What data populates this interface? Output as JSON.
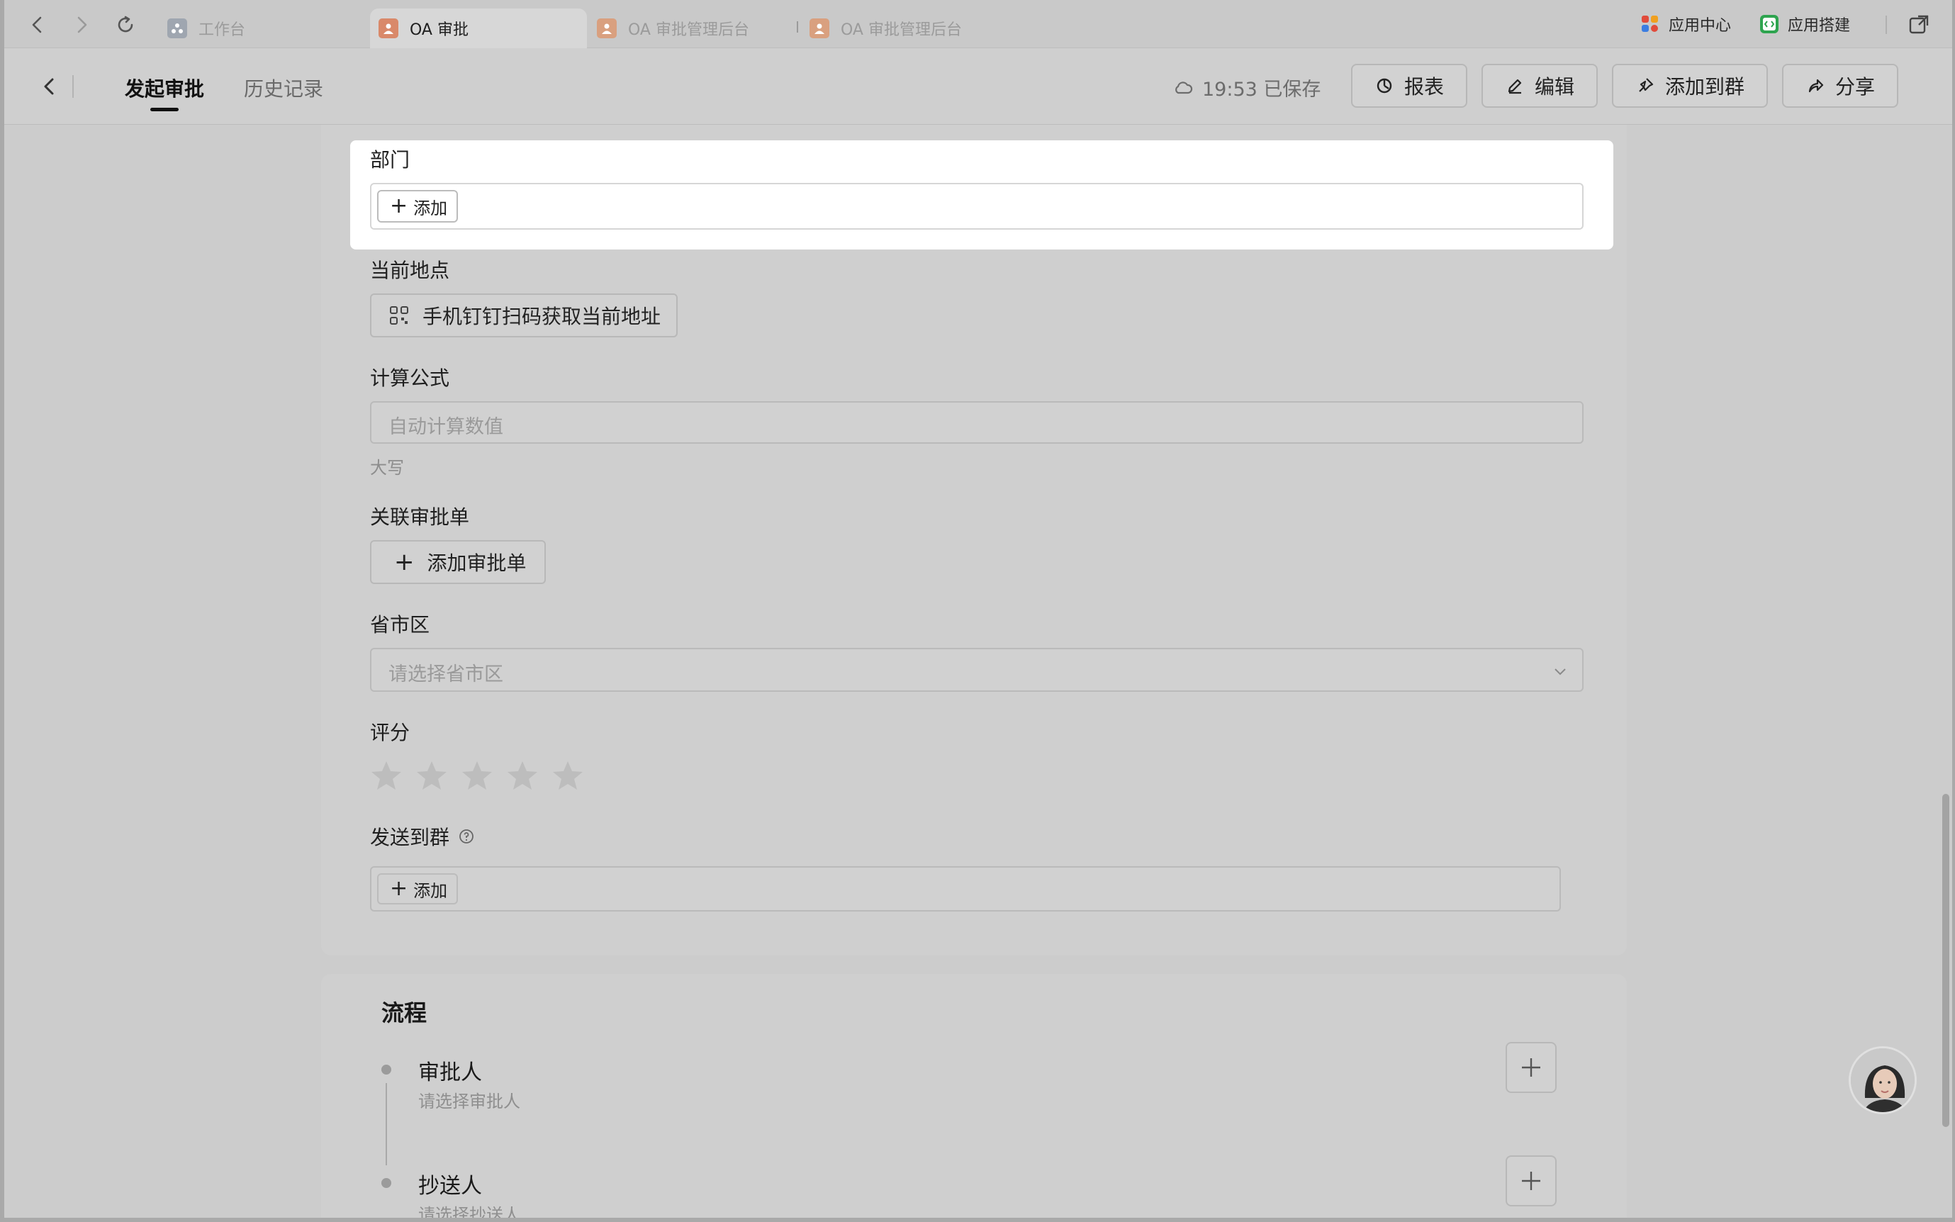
{
  "tabs": [
    {
      "label": "工作台"
    },
    {
      "label": "OA 审批"
    },
    {
      "label": "OA 审批管理后台"
    },
    {
      "label": "OA 审批管理后台"
    }
  ],
  "topright": {
    "app_center": "应用中心",
    "app_builder": "应用搭建"
  },
  "header": {
    "tab_start": "发起审批",
    "tab_history": "历史记录",
    "saved_status": "19:53 已保存",
    "btn_report": "报表",
    "btn_edit": "编辑",
    "btn_add_group": "添加到群",
    "btn_share": "分享"
  },
  "form": {
    "department": {
      "label": "部门",
      "add": "添加"
    },
    "location": {
      "label": "当前地点",
      "button": "手机钉钉扫码获取当前地址"
    },
    "formula": {
      "label": "计算公式",
      "placeholder": "自动计算数值",
      "hint": "大写"
    },
    "related": {
      "label": "关联审批单",
      "button": "添加审批单"
    },
    "region": {
      "label": "省市区",
      "placeholder": "请选择省市区"
    },
    "rating": {
      "label": "评分",
      "value": 0,
      "max": 5
    },
    "send_group": {
      "label": "发送到群",
      "add": "添加"
    }
  },
  "flow": {
    "title": "流程",
    "approver": {
      "title": "审批人",
      "sub": "请选择审批人"
    },
    "cc": {
      "title": "抄送人",
      "sub": "请选择抄送人"
    }
  },
  "colors": {
    "accent_orange": "#d9896a",
    "app_center_red": "#e14b3b",
    "app_builder_green": "#2ea44f"
  }
}
